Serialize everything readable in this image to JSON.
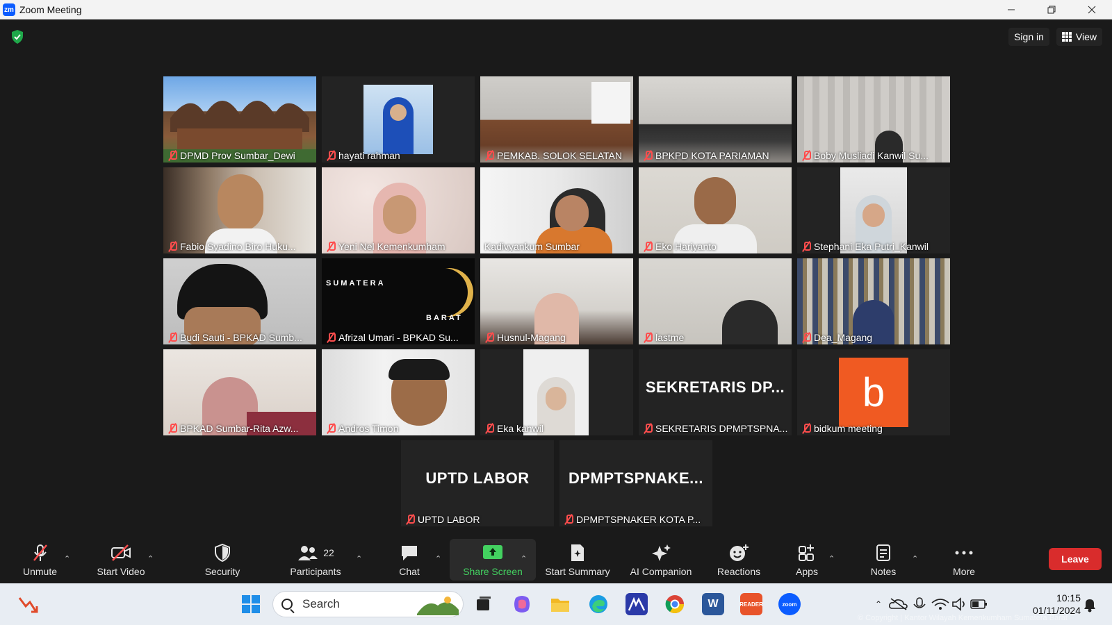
{
  "window": {
    "app_icon": "zm",
    "title": "Zoom Meeting"
  },
  "top_bar": {
    "sign_in": "Sign in",
    "view": "View"
  },
  "participants": [
    {
      "name": "DPMD Prov Sumbar_Dewi",
      "muted": true
    },
    {
      "name": "hayati rahman",
      "muted": true
    },
    {
      "name": "PEMKAB. SOLOK SELATAN",
      "muted": true
    },
    {
      "name": "BPKPD KOTA PARIAMAN",
      "muted": true
    },
    {
      "name": "Boby Musliadi Kanwil Su...",
      "muted": true
    },
    {
      "name": "Fabio Syadino Biro Huku...",
      "muted": true
    },
    {
      "name": "Yeni Nel Kemenkumham",
      "muted": true
    },
    {
      "name": "Kadivyankum Sumbar",
      "muted": false,
      "active_speaker": true
    },
    {
      "name": "Eko Hariyanto",
      "muted": true
    },
    {
      "name": "Stephani Eka Putri_Kanwil",
      "muted": true
    },
    {
      "name": "Budi Sauti - BPKAD Sumb...",
      "muted": true
    },
    {
      "name": "Afrizal Umari - BPKAD Su...",
      "muted": true,
      "banner_top": "SUMATERA",
      "banner_bottom": "BARAT"
    },
    {
      "name": "Husnul-Magang",
      "muted": true
    },
    {
      "name": "lastme",
      "muted": true
    },
    {
      "name": "Dea_Magang",
      "muted": true
    },
    {
      "name": "BPKAD Sumbar-Rita Azw...",
      "muted": true
    },
    {
      "name": "Andros Timon",
      "muted": true
    },
    {
      "name": "Eka kanwil",
      "muted": true
    },
    {
      "name": "SEKRETARIS DPMPTSPNA...",
      "muted": true,
      "display_text": "SEKRETARIS DP..."
    },
    {
      "name": "bidkum meeting",
      "muted": true,
      "avatar_letter": "b"
    },
    {
      "name": "UPTD LABOR",
      "muted": true,
      "display_text": "UPTD LABOR"
    },
    {
      "name": "DPMPTSPNAKER KOTA P...",
      "muted": true,
      "display_text": "DPMPTSPNAKE..."
    }
  ],
  "toolbar": {
    "unmute": "Unmute",
    "start_video": "Start Video",
    "security": "Security",
    "participants": "Participants",
    "participants_count": "22",
    "chat": "Chat",
    "share_screen": "Share Screen",
    "start_summary": "Start Summary",
    "ai_companion": "AI Companion",
    "reactions": "Reactions",
    "apps": "Apps",
    "notes": "Notes",
    "more": "More",
    "leave": "Leave"
  },
  "taskbar": {
    "search_placeholder": "Search",
    "time": "10:15",
    "date": "01/11/2024",
    "copyright": "© Copyright | Kantor Wilayah Kemenkumham Sumatera Barat",
    "reader_label": "READER",
    "zoom_label": "zoom"
  },
  "colors": {
    "leave": "#d92c2c",
    "share_green": "#43d160",
    "mute_red": "#ff4d4d",
    "active_border": "#e7e86a",
    "bidkum_orange": "#f05a22"
  }
}
